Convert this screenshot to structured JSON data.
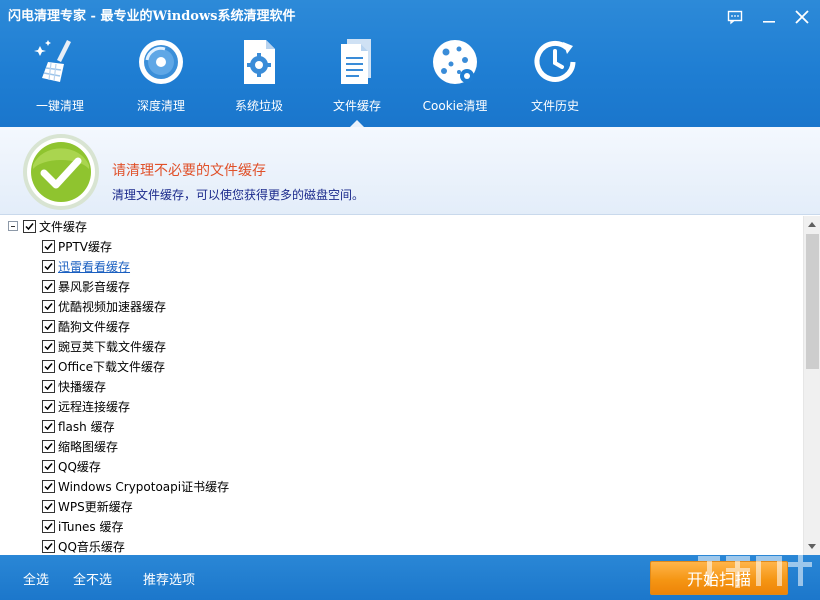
{
  "app": {
    "title": "闪电清理专家 - 最专业的Windows系统清理软件"
  },
  "nav": {
    "items": [
      {
        "label": "一键清理",
        "icon": "broom-icon"
      },
      {
        "label": "深度清理",
        "icon": "disk-icon"
      },
      {
        "label": "系统垃圾",
        "icon": "gear-document-icon"
      },
      {
        "label": "文件缓存",
        "icon": "document-stack-icon",
        "active": true
      },
      {
        "label": "Cookie清理",
        "icon": "cookie-icon"
      },
      {
        "label": "文件历史",
        "icon": "clock-history-icon"
      }
    ]
  },
  "banner": {
    "title": "请清理不必要的文件缓存",
    "subtitle": "清理文件缓存，可以使您获得更多的磁盘空间。",
    "title_color": "#e0512a",
    "subtitle_color": "#1b2a8c"
  },
  "tree": {
    "root_label": "文件缓存",
    "items": [
      {
        "label": "PPTV缓存",
        "checked": true
      },
      {
        "label": "迅雷看看缓存",
        "checked": true,
        "link": true
      },
      {
        "label": "暴风影音缓存",
        "checked": true
      },
      {
        "label": "优酷视频加速器缓存",
        "checked": true
      },
      {
        "label": "酷狗文件缓存",
        "checked": true
      },
      {
        "label": "豌豆荚下载文件缓存",
        "checked": true
      },
      {
        "label": "Office下载文件缓存",
        "checked": true
      },
      {
        "label": "快播缓存",
        "checked": true
      },
      {
        "label": "远程连接缓存",
        "checked": true
      },
      {
        "label": "flash 缓存",
        "checked": true
      },
      {
        "label": "缩略图缓存",
        "checked": true
      },
      {
        "label": "QQ缓存",
        "checked": true
      },
      {
        "label": "Windows Crypotoapi证书缓存",
        "checked": true
      },
      {
        "label": "WPS更新缓存",
        "checked": true
      },
      {
        "label": "iTunes 缓存",
        "checked": true
      },
      {
        "label": "QQ音乐缓存",
        "checked": true
      }
    ]
  },
  "footer": {
    "select_all": "全选",
    "select_none": "全不选",
    "recommended": "推荐选项",
    "scan_button": "开始扫描"
  },
  "colors": {
    "header_blue": "#1f7ed3",
    "scan_orange": "#f59614"
  }
}
